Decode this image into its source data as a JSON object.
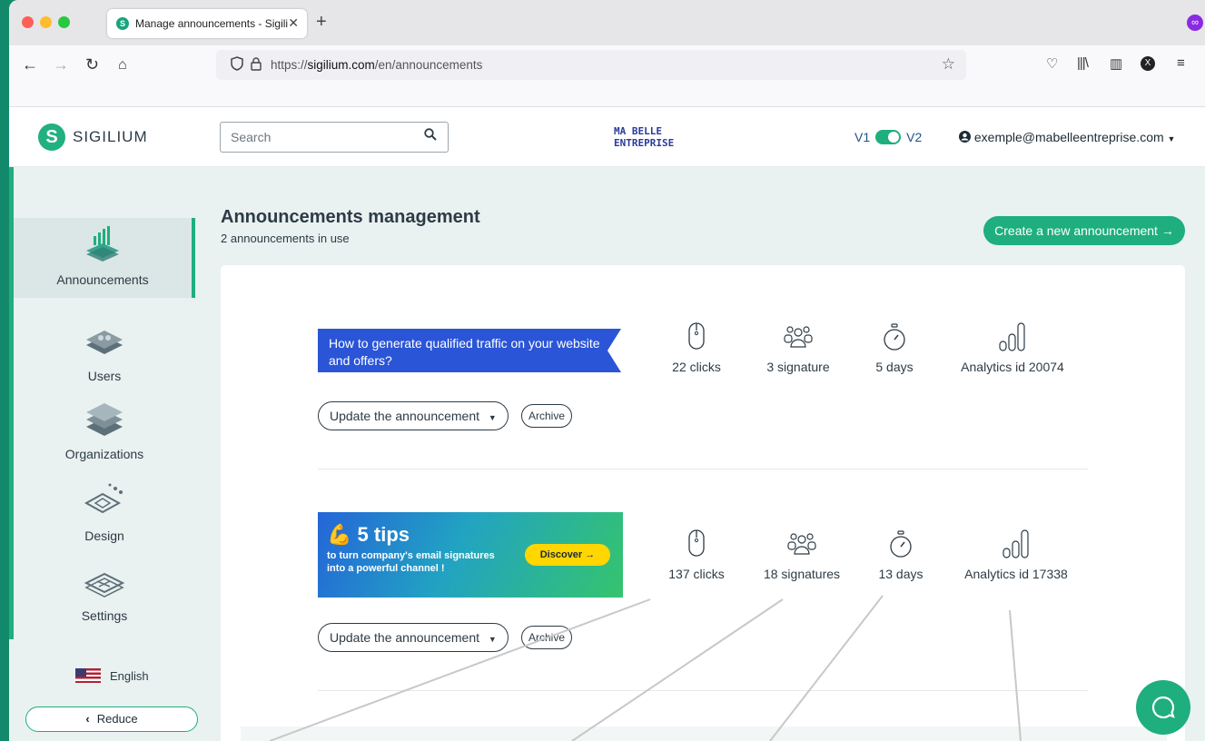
{
  "browser": {
    "tab_title": "Manage announcements - Sigili",
    "url_prefix": "https://",
    "url_host": "sigilium.com",
    "url_path": "/en/announcements"
  },
  "header": {
    "logo_text": "SIGILIUM",
    "search_placeholder": "Search",
    "brand_line1": "MA BELLE",
    "brand_line2": "ENTREPRISE",
    "version_v1": "V1",
    "version_v2": "V2",
    "user_email": "exemple@mabelleentreprise.com"
  },
  "sidebar": {
    "items": [
      {
        "label": "Announcements",
        "icon": "announcements-icon"
      },
      {
        "label": "Users",
        "icon": "users-icon"
      },
      {
        "label": "Organizations",
        "icon": "organizations-icon"
      },
      {
        "label": "Design",
        "icon": "design-icon"
      },
      {
        "label": "Settings",
        "icon": "settings-icon"
      }
    ],
    "language": "English",
    "reduce_label": "Reduce"
  },
  "main": {
    "title": "Announcements management",
    "subtitle": "2 announcements in use",
    "create_label": "Create a new announcement →",
    "announcements": [
      {
        "banner_text": "How to generate qualified traffic on your website and offers?",
        "clicks": "22 clicks",
        "signatures": "3 signature",
        "days": "5 days",
        "analytics": "Analytics id 20074",
        "update_label": "Update the announcement",
        "archive_label": "Archive"
      },
      {
        "banner_big": "5 tips",
        "banner_small_1": "to turn company's email signatures",
        "banner_small_2": "into a powerful channel !",
        "banner_cta": "Discover →",
        "clicks": "137 clicks",
        "signatures": "18 signatures",
        "days": "13 days",
        "analytics": "Analytics id 17338",
        "update_label": "Update the announcement",
        "archive_label": "Archive"
      }
    ]
  },
  "colors": {
    "accent": "#1fae7e",
    "banner_blue": "#2b55d7",
    "text": "#2d3b45"
  }
}
